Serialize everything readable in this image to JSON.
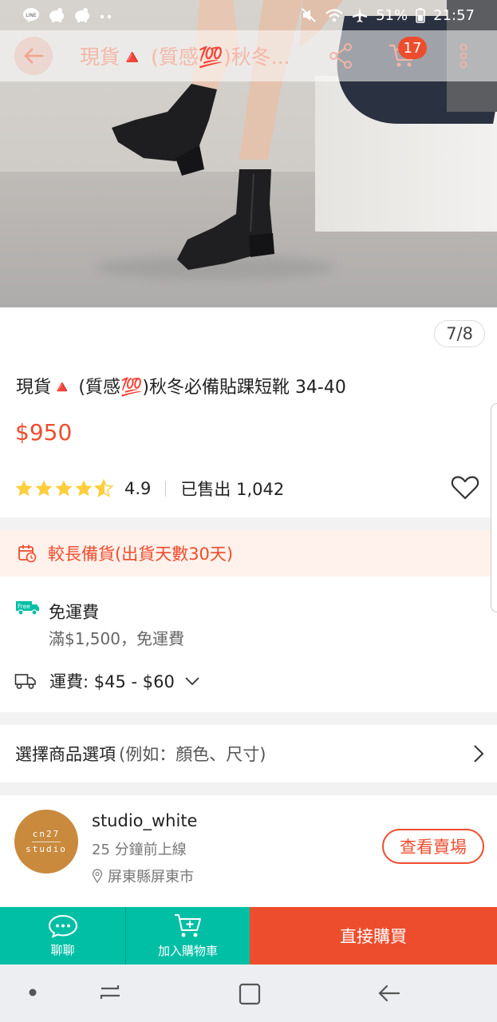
{
  "status_bar": {
    "battery": "51%",
    "time": "21:57",
    "icons": [
      "line-icon",
      "piggy-icon",
      "piggy-icon",
      "more-dots-icon",
      "mute-icon",
      "wifi-icon",
      "airplane-icon",
      "battery-icon"
    ]
  },
  "header": {
    "title": "現貨🔺 (質感💯)秋冬...",
    "cart_count": "17"
  },
  "gallery": {
    "counter": "7/8"
  },
  "product": {
    "title": "現貨🔺 (質感💯)秋冬必備貼踝短靴 34-40",
    "price": "$950",
    "rating": "4.9",
    "rating_stars": 4.5,
    "sold": "已售出 1,042"
  },
  "notice": {
    "text": "較長備貨(出貨天數30天)"
  },
  "shipping": {
    "free_badge": "Free",
    "free_title": "免運費",
    "free_condition": "滿$1,500，免運費",
    "fee": "運費: $45 - $60"
  },
  "options": {
    "label": "選擇商品選項",
    "hint": "(例如：顏色、尺寸)"
  },
  "shop": {
    "logo_line1": "cn27",
    "logo_line2": "studio",
    "name": "studio_white",
    "online": "25 分鐘前上線",
    "location": "屏東縣屏東市",
    "view_button": "查看賣場"
  },
  "bottom_bar": {
    "chat": "聊聊",
    "add_to_cart": "加入購物車",
    "buy_now": "直接購買"
  },
  "colors": {
    "brand": "#ee4d2d",
    "teal": "#00bfa5",
    "star": "#ffce3d"
  }
}
